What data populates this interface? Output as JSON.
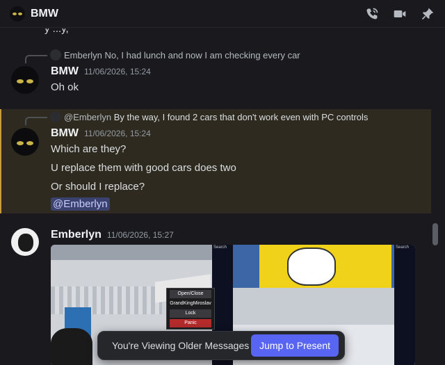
{
  "header": {
    "title": "BMW",
    "icons": [
      "phone-call-icon",
      "video-camera-icon",
      "pin-icon"
    ]
  },
  "fragment": "y   ...y,",
  "messages": [
    {
      "reply": {
        "author": "Emberlyn",
        "text": "No, I had lunch and now I am checking every car"
      },
      "author": "BMW",
      "time": "11/06/2026, 15:24",
      "lines": [
        "Oh ok"
      ]
    },
    {
      "reply": {
        "author": "@Emberlyn",
        "text": "By the way, I found 2 cars that don't work even with PC controls"
      },
      "author": "BMW",
      "time": "11/06/2026, 15:24",
      "lines": [
        "Which are they?",
        "U replace them with good cars does two",
        "Or should I replace?"
      ],
      "mention": "@Emberlyn"
    },
    {
      "author": "Emberlyn",
      "time": "11/06/2026, 15:27",
      "attachment": {
        "menu": [
          "Open/Close",
          "GrandKingMiroslav",
          "Lock",
          "Panic"
        ],
        "panel_label": "Search"
      }
    }
  ],
  "jump_bar": {
    "text": "You're Viewing Older Messages",
    "button": "Jump to Present"
  },
  "colors": {
    "accent": "#5865f2",
    "mention_bg": "#2e2a20",
    "mention_border": "#c69b3c"
  }
}
